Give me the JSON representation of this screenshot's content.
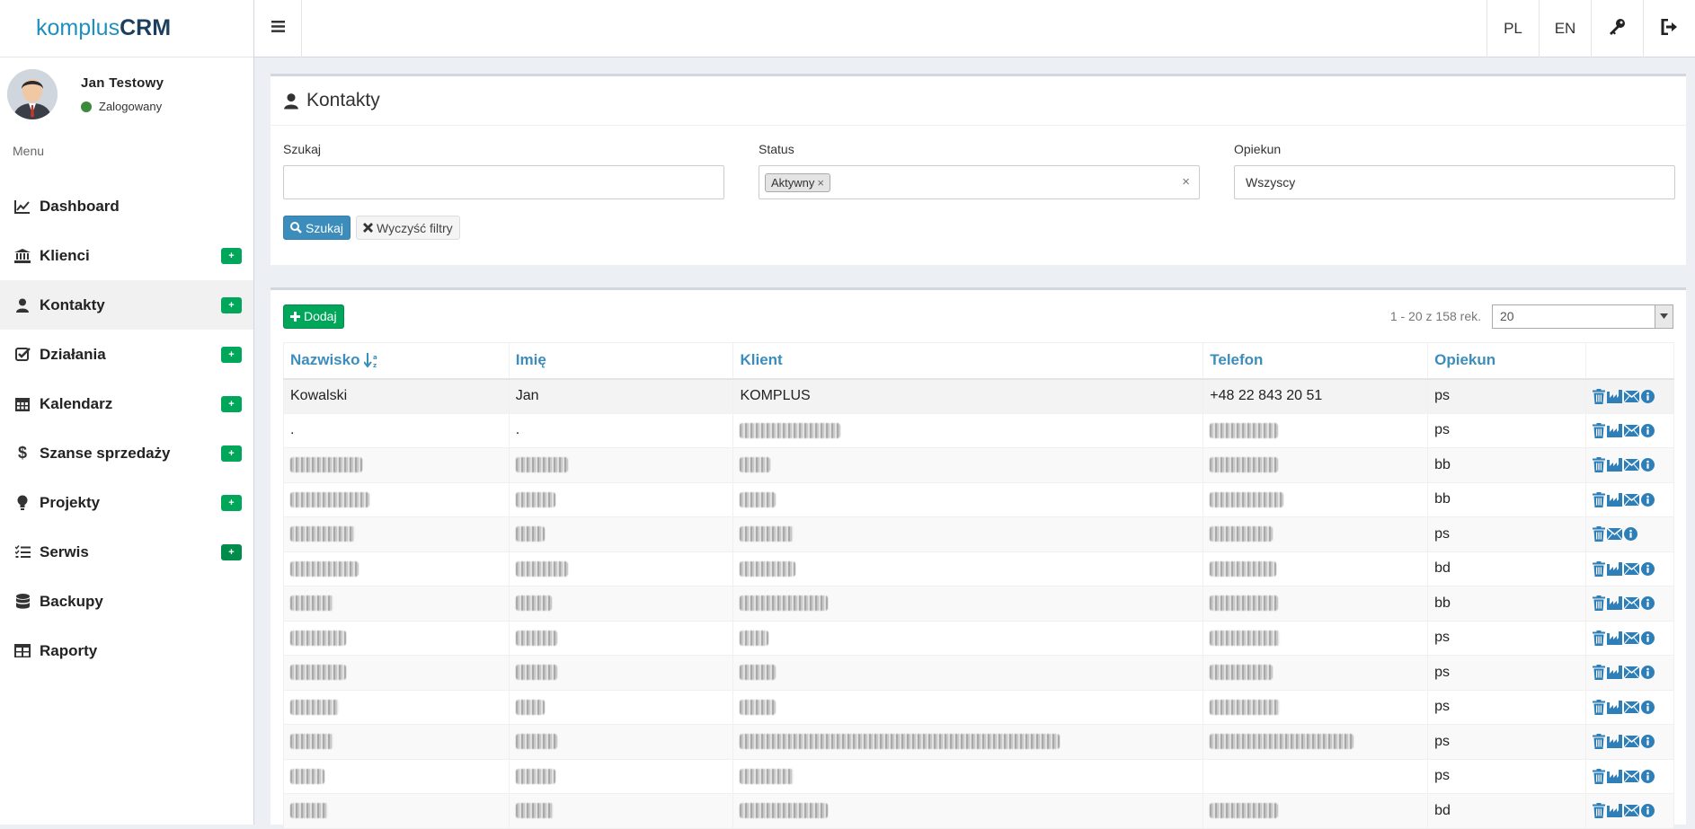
{
  "app": {
    "logo_a": "komplus",
    "logo_b": "CRM"
  },
  "user": {
    "name": "Jan Testowy",
    "status": "Zalogowany"
  },
  "menu_header": "Menu",
  "menu": [
    {
      "label": "Dashboard",
      "icon": "chart-line-icon",
      "plus": false
    },
    {
      "label": "Klienci",
      "icon": "bank-icon",
      "plus": true
    },
    {
      "label": "Kontakty",
      "icon": "user-icon",
      "plus": true,
      "active": true
    },
    {
      "label": "Działania",
      "icon": "check-square-icon",
      "plus": true
    },
    {
      "label": "Kalendarz",
      "icon": "calendar-icon",
      "plus": true
    },
    {
      "label": "Szanse sprzedaży",
      "icon": "dollar-icon",
      "plus": true
    },
    {
      "label": "Projekty",
      "icon": "lightbulb-icon",
      "plus": true
    },
    {
      "label": "Serwis",
      "icon": "list-check-icon",
      "plus": true
    },
    {
      "label": "Backupy",
      "icon": "database-icon",
      "plus": false
    },
    {
      "label": "Raporty",
      "icon": "table-icon",
      "plus": false
    }
  ],
  "menu_plus_label": "+",
  "topbar": {
    "lang_pl": "PL",
    "lang_en": "EN"
  },
  "page": {
    "title": "Kontakty",
    "filters": {
      "search_label": "Szukaj",
      "search_value": "",
      "status_label": "Status",
      "status_tag": "Aktywny",
      "owner_label": "Opiekun",
      "owner_value": "Wszyscy"
    },
    "search_button": "Szukaj",
    "clear_button": "Wyczyść filtry",
    "add_button": "Dodaj",
    "pager_info": "1 - 20 z 158 rek.",
    "page_size": "20"
  },
  "table": {
    "columns": [
      "Nazwisko",
      "Imię",
      "Klient",
      "Telefon",
      "Opiekun"
    ],
    "rows": [
      {
        "nazwisko": "Kowalski",
        "imie": "Jan",
        "klient": "KOMPLUS",
        "telefon": "+48 22 843 20 51",
        "opiekun": "ps"
      },
      {
        "nazwisko": ".",
        "imie": ".",
        "klient": "",
        "telefon": "",
        "opiekun": "ps"
      },
      {
        "nazwisko": "",
        "imie": "",
        "klient": "",
        "telefon": "",
        "opiekun": "bb"
      },
      {
        "nazwisko": "",
        "imie": "",
        "klient": "",
        "telefon": "",
        "opiekun": "bb"
      },
      {
        "nazwisko": "",
        "imie": "",
        "klient": "",
        "telefon": "",
        "opiekun": "ps"
      },
      {
        "nazwisko": "",
        "imie": "",
        "klient": "",
        "telefon": "",
        "opiekun": "bd"
      },
      {
        "nazwisko": "",
        "imie": "",
        "klient": "",
        "telefon": "",
        "opiekun": "bb"
      },
      {
        "nazwisko": "",
        "imie": "",
        "klient": "",
        "telefon": "",
        "opiekun": "ps"
      },
      {
        "nazwisko": "",
        "imie": "",
        "klient": "",
        "telefon": "",
        "opiekun": "ps"
      },
      {
        "nazwisko": "",
        "imie": "",
        "klient": "",
        "telefon": "",
        "opiekun": "ps"
      },
      {
        "nazwisko": "",
        "imie": "",
        "klient": "",
        "telefon": "",
        "opiekun": "ps"
      },
      {
        "nazwisko": "",
        "imie": "",
        "klient": "",
        "telefon": "",
        "opiekun": "ps"
      },
      {
        "nazwisko": "",
        "imie": "",
        "klient": "",
        "telefon": "",
        "opiekun": "bd"
      }
    ]
  },
  "colors": {
    "accent": "#3c8dbc",
    "success": "#00a65a",
    "online": "#3c8b3c",
    "icon_blue": "#2e7fb8"
  }
}
